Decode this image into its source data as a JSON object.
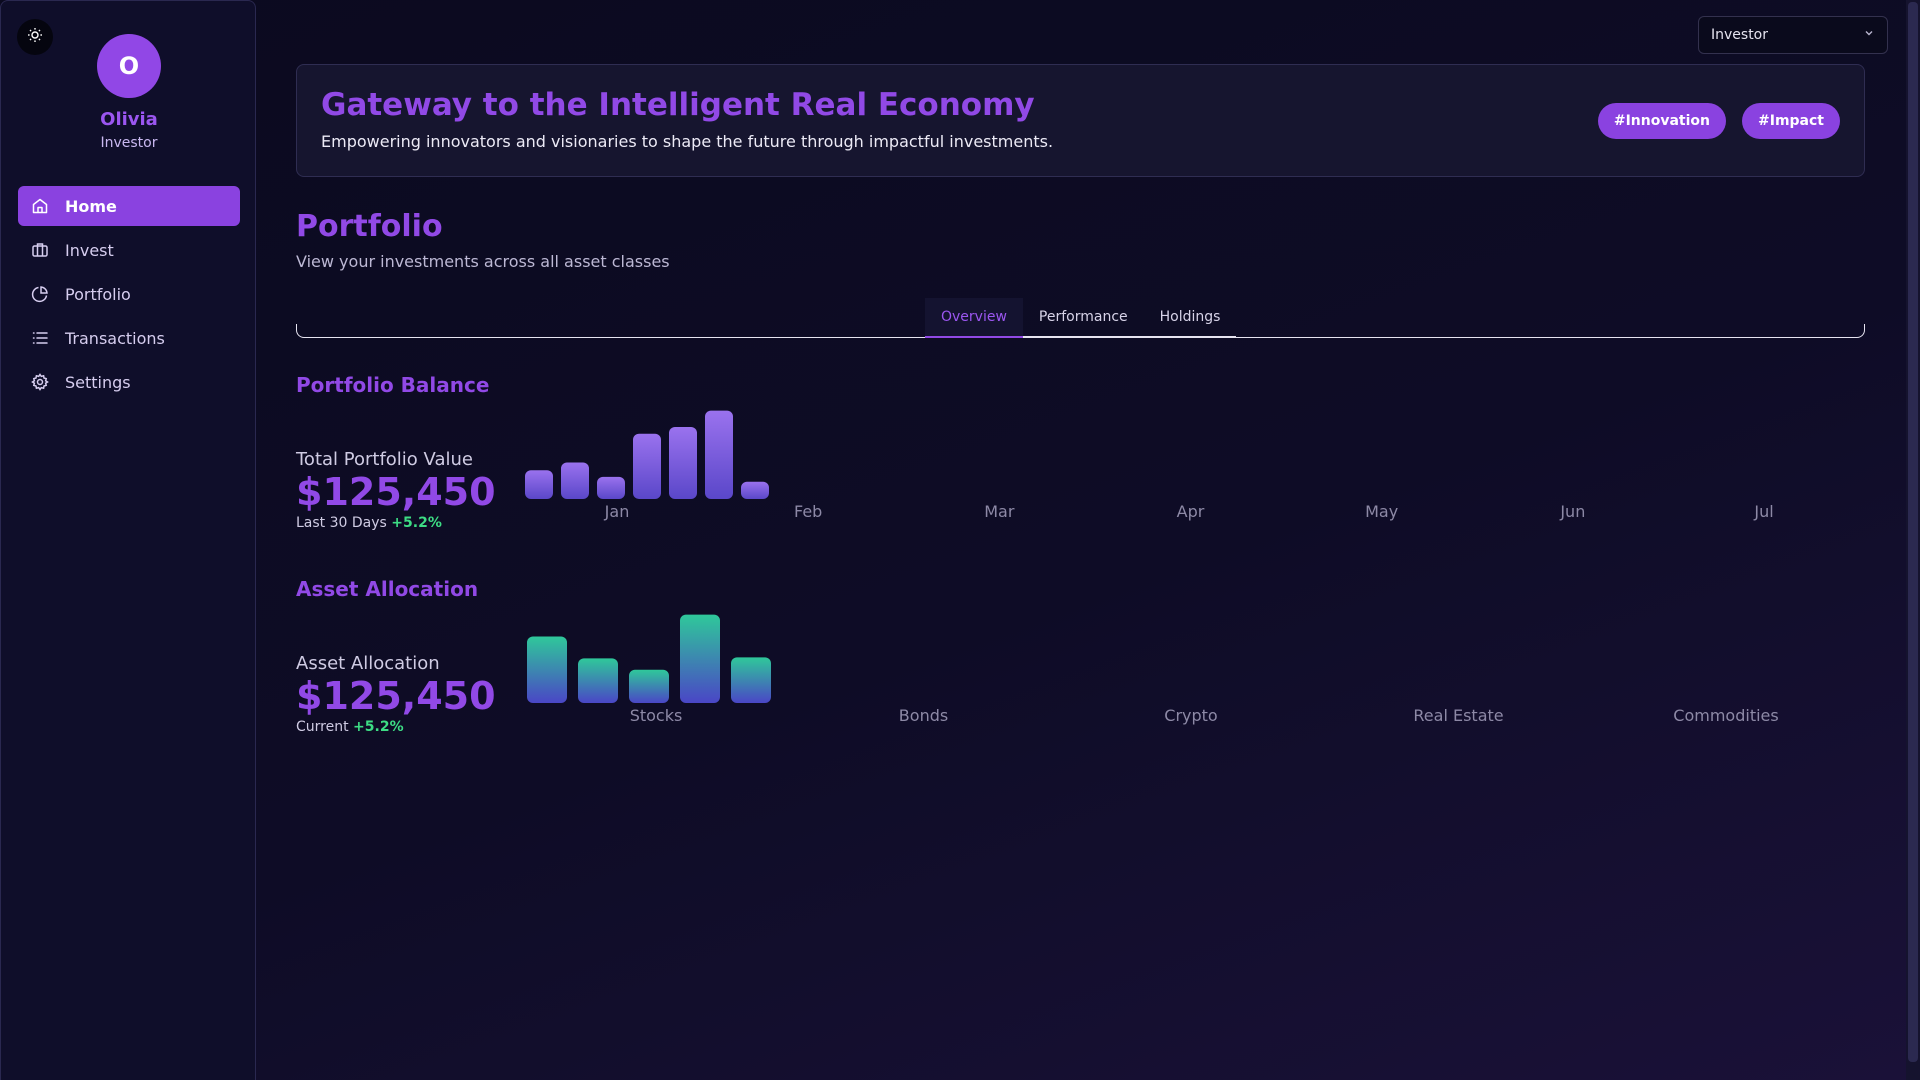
{
  "user": {
    "initial": "O",
    "name": "Olivia",
    "role": "Investor"
  },
  "sidebar": {
    "items": [
      {
        "label": "Home",
        "icon": "home-icon",
        "active": true
      },
      {
        "label": "Invest",
        "icon": "briefcase-icon",
        "active": false
      },
      {
        "label": "Portfolio",
        "icon": "pie-chart-icon",
        "active": false
      },
      {
        "label": "Transactions",
        "icon": "list-icon",
        "active": false
      },
      {
        "label": "Settings",
        "icon": "gear-icon",
        "active": false
      }
    ]
  },
  "role_select": {
    "value": "Investor"
  },
  "hero": {
    "title": "Gateway to the Intelligent Real Economy",
    "subtitle": "Empowering innovators and visionaries to shape the future through impactful investments.",
    "tags": [
      "#Innovation",
      "#Impact"
    ]
  },
  "page": {
    "title": "Portfolio",
    "subtitle": "View your investments across all asset classes"
  },
  "tabs": [
    {
      "label": "Overview",
      "active": true
    },
    {
      "label": "Performance",
      "active": false
    },
    {
      "label": "Holdings",
      "active": false
    }
  ],
  "balance": {
    "section_title": "Portfolio Balance",
    "label": "Total Portfolio Value",
    "value": "$125,450",
    "period": "Last 30 Days",
    "change": "+5.2%"
  },
  "allocation": {
    "section_title": "Asset Allocation",
    "label": "Asset Allocation",
    "value": "$125,450",
    "period": "Current",
    "change": "+5.2%"
  },
  "colors": {
    "accent": "#9149e6",
    "positive": "#3ddc84",
    "balance_bar_top": "#9a72ee",
    "balance_bar_bottom": "#5a47c9",
    "alloc_bar_top": "#2fc89a",
    "alloc_bar_bottom": "#4a46c6"
  },
  "chart_data": [
    {
      "type": "bar",
      "categories": [
        "Jan",
        "Feb",
        "Mar",
        "Apr",
        "May",
        "Jun",
        "Jul"
      ],
      "values": [
        30,
        38,
        23,
        68,
        75,
        92,
        18
      ],
      "ylim": [
        0,
        100
      ],
      "grid": false,
      "legend": "none"
    },
    {
      "type": "bar",
      "categories": [
        "Stocks",
        "Bonds",
        "Crypto",
        "Real Estate",
        "Commodities"
      ],
      "values": [
        70,
        47,
        35,
        93,
        48
      ],
      "ylim": [
        0,
        100
      ],
      "grid": false,
      "legend": "none"
    }
  ]
}
